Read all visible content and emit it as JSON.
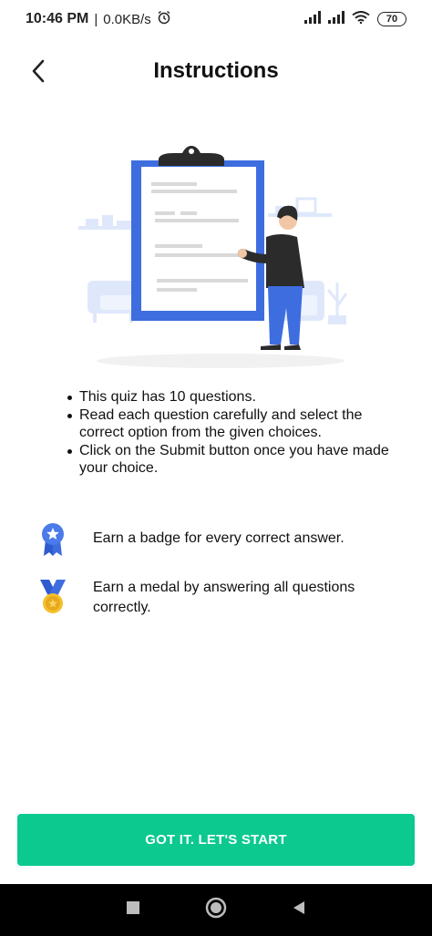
{
  "status_bar": {
    "time": "10:46 PM",
    "separator": "|",
    "speed": "0.0KB/s",
    "battery": "70"
  },
  "app_bar": {
    "title": "Instructions",
    "back_icon": "chevron-left-icon"
  },
  "illustration": {
    "icon": "clipboard-person-illustration",
    "colors": {
      "board": "#3e6ddf",
      "paper": "#ffffff",
      "lines": "#d9d9d9",
      "furniture": "#dfe8fb",
      "shirt": "#2b2b2b",
      "pants": "#3e6ddf"
    }
  },
  "instructions": [
    "This quiz has 10 questions.",
    "Read each question carefully and select the correct option from the given choices.",
    "Click on the Submit button once you have made your choice."
  ],
  "rewards": [
    {
      "icon": "badge-ribbon-icon",
      "text": "Earn a badge for every correct answer."
    },
    {
      "icon": "medal-icon",
      "text": "Earn a medal by answering all questions correctly."
    }
  ],
  "cta": {
    "label": "GOT IT. LET'S START",
    "color": "#0bc98f"
  },
  "nav_bar": {
    "icons": [
      "square-recents-icon",
      "circle-home-icon",
      "triangle-back-icon"
    ]
  }
}
